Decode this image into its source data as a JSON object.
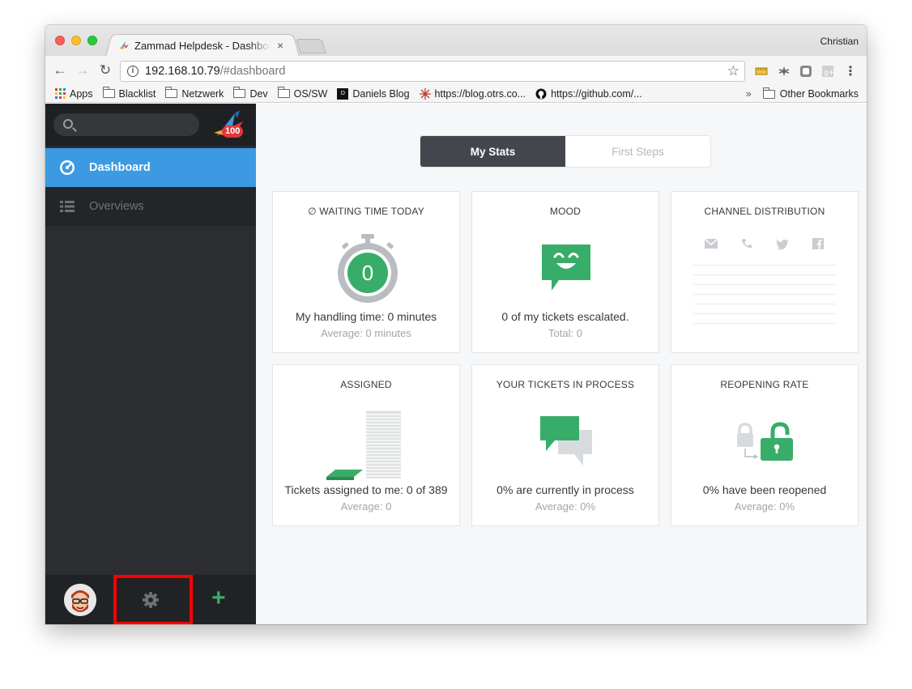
{
  "browser": {
    "tab_title": "Zammad Helpdesk - Dashboard",
    "tab_close": "×",
    "profile_name": "Christian",
    "url_host": "192.168.10.79",
    "url_path": "/#dashboard",
    "nav_back": "←",
    "nav_forward": "→",
    "nav_reload": "↻",
    "info": "i",
    "star": "☆",
    "menu": "⋮",
    "bookmarks": [
      {
        "label": "Apps"
      },
      {
        "label": "Blacklist"
      },
      {
        "label": "Netzwerk"
      },
      {
        "label": "Dev"
      },
      {
        "label": "OS/SW"
      },
      {
        "label": "Daniels Blog"
      },
      {
        "label": "https://blog.otrs.co..."
      },
      {
        "label": "https://github.com/..."
      }
    ],
    "bookmarks_overflow": "»",
    "other_bookmarks": "Other Bookmarks"
  },
  "sidebar": {
    "logo_badge": "100",
    "nav": [
      {
        "label": "Dashboard",
        "icon": "dashboard-icon"
      },
      {
        "label": "Overviews",
        "icon": "list-icon"
      }
    ],
    "plus": "+"
  },
  "main": {
    "tabs": [
      {
        "label": "My Stats",
        "active": true
      },
      {
        "label": "First Steps",
        "active": false
      }
    ],
    "cards": [
      {
        "title": "∅ WAITING TIME TODAY",
        "main": "My handling time: 0 minutes",
        "sub": "Average: 0 minutes",
        "value": "0"
      },
      {
        "title": "MOOD",
        "main": "0 of my tickets escalated.",
        "sub": "Total: 0"
      },
      {
        "title": "CHANNEL DISTRIBUTION"
      },
      {
        "title": "ASSIGNED",
        "main": "Tickets assigned to me: 0 of 389",
        "sub": "Average: 0"
      },
      {
        "title": "YOUR TICKETS IN PROCESS",
        "main": "0% are currently in process",
        "sub": "Average: 0%"
      },
      {
        "title": "REOPENING RATE",
        "main": "0% have been reopened",
        "sub": "Average: 0%"
      }
    ]
  },
  "colors": {
    "accent": "#3b9ae1",
    "green": "#38ad69",
    "highlight": "#ff0000"
  }
}
